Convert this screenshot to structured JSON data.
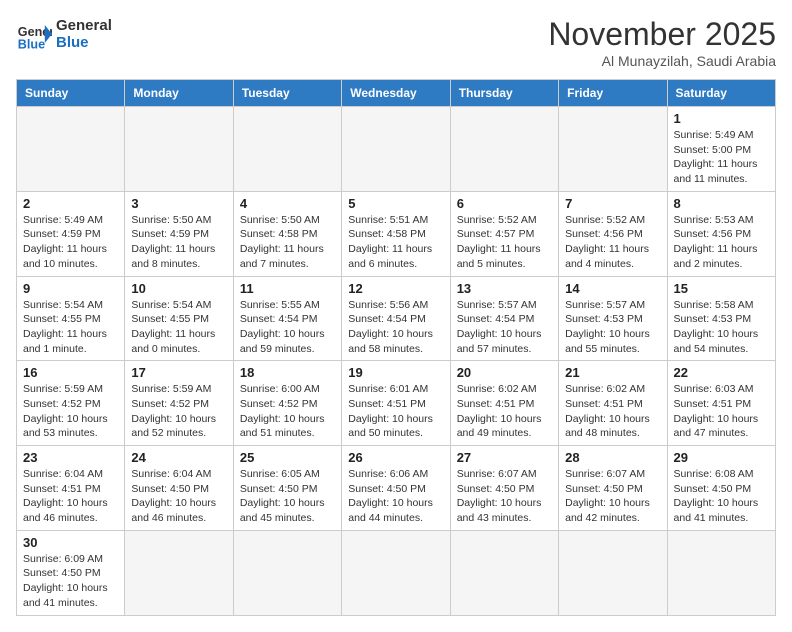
{
  "header": {
    "logo_general": "General",
    "logo_blue": "Blue",
    "month": "November 2025",
    "location": "Al Munayzilah, Saudi Arabia"
  },
  "weekdays": [
    "Sunday",
    "Monday",
    "Tuesday",
    "Wednesday",
    "Thursday",
    "Friday",
    "Saturday"
  ],
  "days": {
    "1": {
      "sunrise": "5:49 AM",
      "sunset": "5:00 PM",
      "daylight": "11 hours and 11 minutes."
    },
    "2": {
      "sunrise": "5:49 AM",
      "sunset": "4:59 PM",
      "daylight": "11 hours and 10 minutes."
    },
    "3": {
      "sunrise": "5:50 AM",
      "sunset": "4:59 PM",
      "daylight": "11 hours and 8 minutes."
    },
    "4": {
      "sunrise": "5:50 AM",
      "sunset": "4:58 PM",
      "daylight": "11 hours and 7 minutes."
    },
    "5": {
      "sunrise": "5:51 AM",
      "sunset": "4:58 PM",
      "daylight": "11 hours and 6 minutes."
    },
    "6": {
      "sunrise": "5:52 AM",
      "sunset": "4:57 PM",
      "daylight": "11 hours and 5 minutes."
    },
    "7": {
      "sunrise": "5:52 AM",
      "sunset": "4:56 PM",
      "daylight": "11 hours and 4 minutes."
    },
    "8": {
      "sunrise": "5:53 AM",
      "sunset": "4:56 PM",
      "daylight": "11 hours and 2 minutes."
    },
    "9": {
      "sunrise": "5:54 AM",
      "sunset": "4:55 PM",
      "daylight": "11 hours and 1 minute."
    },
    "10": {
      "sunrise": "5:54 AM",
      "sunset": "4:55 PM",
      "daylight": "11 hours and 0 minutes."
    },
    "11": {
      "sunrise": "5:55 AM",
      "sunset": "4:54 PM",
      "daylight": "10 hours and 59 minutes."
    },
    "12": {
      "sunrise": "5:56 AM",
      "sunset": "4:54 PM",
      "daylight": "10 hours and 58 minutes."
    },
    "13": {
      "sunrise": "5:57 AM",
      "sunset": "4:54 PM",
      "daylight": "10 hours and 57 minutes."
    },
    "14": {
      "sunrise": "5:57 AM",
      "sunset": "4:53 PM",
      "daylight": "10 hours and 55 minutes."
    },
    "15": {
      "sunrise": "5:58 AM",
      "sunset": "4:53 PM",
      "daylight": "10 hours and 54 minutes."
    },
    "16": {
      "sunrise": "5:59 AM",
      "sunset": "4:52 PM",
      "daylight": "10 hours and 53 minutes."
    },
    "17": {
      "sunrise": "5:59 AM",
      "sunset": "4:52 PM",
      "daylight": "10 hours and 52 minutes."
    },
    "18": {
      "sunrise": "6:00 AM",
      "sunset": "4:52 PM",
      "daylight": "10 hours and 51 minutes."
    },
    "19": {
      "sunrise": "6:01 AM",
      "sunset": "4:51 PM",
      "daylight": "10 hours and 50 minutes."
    },
    "20": {
      "sunrise": "6:02 AM",
      "sunset": "4:51 PM",
      "daylight": "10 hours and 49 minutes."
    },
    "21": {
      "sunrise": "6:02 AM",
      "sunset": "4:51 PM",
      "daylight": "10 hours and 48 minutes."
    },
    "22": {
      "sunrise": "6:03 AM",
      "sunset": "4:51 PM",
      "daylight": "10 hours and 47 minutes."
    },
    "23": {
      "sunrise": "6:04 AM",
      "sunset": "4:51 PM",
      "daylight": "10 hours and 46 minutes."
    },
    "24": {
      "sunrise": "6:04 AM",
      "sunset": "4:50 PM",
      "daylight": "10 hours and 46 minutes."
    },
    "25": {
      "sunrise": "6:05 AM",
      "sunset": "4:50 PM",
      "daylight": "10 hours and 45 minutes."
    },
    "26": {
      "sunrise": "6:06 AM",
      "sunset": "4:50 PM",
      "daylight": "10 hours and 44 minutes."
    },
    "27": {
      "sunrise": "6:07 AM",
      "sunset": "4:50 PM",
      "daylight": "10 hours and 43 minutes."
    },
    "28": {
      "sunrise": "6:07 AM",
      "sunset": "4:50 PM",
      "daylight": "10 hours and 42 minutes."
    },
    "29": {
      "sunrise": "6:08 AM",
      "sunset": "4:50 PM",
      "daylight": "10 hours and 41 minutes."
    },
    "30": {
      "sunrise": "6:09 AM",
      "sunset": "4:50 PM",
      "daylight": "10 hours and 41 minutes."
    }
  },
  "labels": {
    "sunrise": "Sunrise:",
    "sunset": "Sunset:",
    "daylight": "Daylight:"
  }
}
